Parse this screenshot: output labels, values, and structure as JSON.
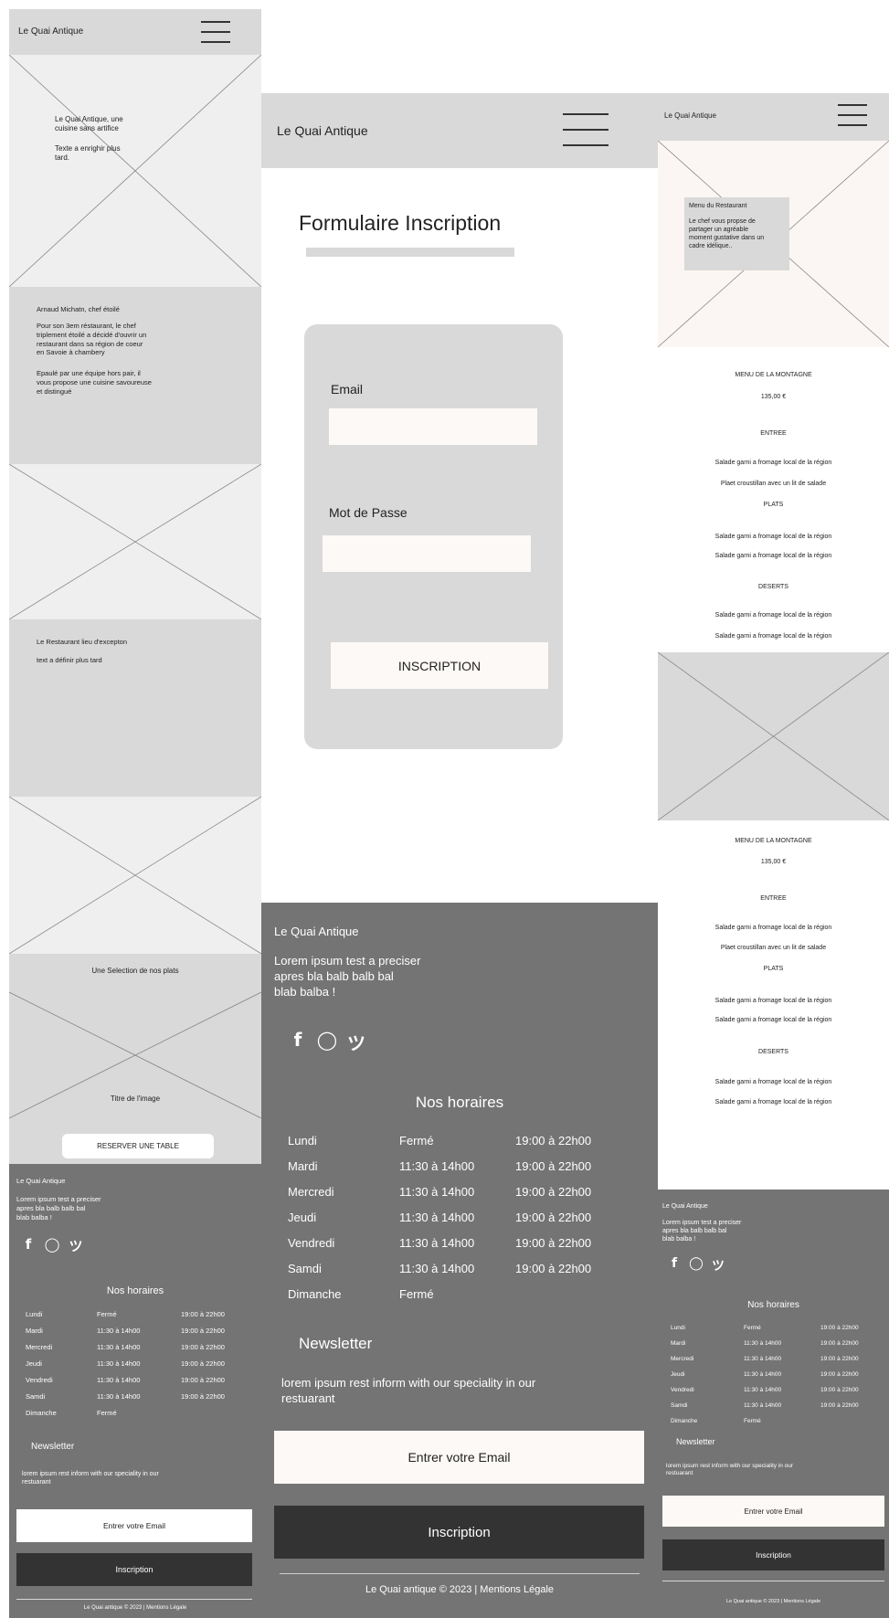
{
  "brand": "Le Quai Antique",
  "colors": {
    "header_bg": "#d9d9d9",
    "placeholder_bg": "#efefef",
    "section_bg": "#d9d9d9",
    "footer_bg": "#747474",
    "dark_button": "#333333",
    "light_field": "#fdf9f6"
  },
  "home": {
    "hero": {
      "title": "Le Quai Antique, une\ncuisine sans artifice",
      "subtitle": "Texte a enrighir plus\ntard."
    },
    "chef": {
      "title": "Arnaud Michatn, chef étoilé",
      "p1": "Pour son 3em réstaurant, le chef\ntriplement étoilé a décidé d'ouvrir un\nrestaurant dans sa région de coeur\nen Savoie à chambery",
      "p2": "Epaulé par une équipe hors pair, il\nvous propose une cuisine savoureuse\net distingué"
    },
    "restaurant": {
      "title": "Le Restaurant lieu d'excepton",
      "text": "text a définir plus tard"
    },
    "selection": {
      "title": "Une Selection de nos plats",
      "image_title": "Titre de l'image",
      "reserve_button": "RESERVER UNE TABLE"
    }
  },
  "signup": {
    "title": "Formulaire Inscription",
    "email_label": "Email",
    "password_label": "Mot de Passe",
    "submit": "INSCRIPTION"
  },
  "menu": {
    "hero_card": {
      "title": "Menu du Restaurant",
      "text": "Le chef vous propse de\npartager un agréable\nmoment gustative dans un\ncadre idélique.."
    },
    "blocks": [
      {
        "name": "MENU DE LA MONTAGNE",
        "price": "135,00 €",
        "entree_title": "ENTREE",
        "entree": [
          "Salade garni a fromage local de la région",
          "Plaet croustillan avec un lit de salade"
        ],
        "plats_title": "PLATS",
        "plats": [
          "Salade garni a fromage local de la région",
          "Salade garni a fromage local de la région"
        ],
        "deserts_title": "DESERTS",
        "deserts": [
          "Salade garni a fromage local de la région",
          "Salade garni a fromage local de la région"
        ]
      },
      {
        "name": "MENU DE LA MONTAGNE",
        "price": "135,00 €",
        "entree_title": "ENTREE",
        "entree": [
          "Salade garni a fromage local de la région",
          "Plaet croustillan avec un lit de salade"
        ],
        "plats_title": "PLATS",
        "plats": [
          "Salade garni a fromage local de la région",
          "Salade garni a fromage local de la région"
        ],
        "deserts_title": "DESERTS",
        "deserts": [
          "Salade garni a fromage local de la région",
          "Salade garni a fromage local de la région"
        ]
      }
    ]
  },
  "footer": {
    "brand": "Le Quai Antique",
    "text": "Lorem ipsum test a preciser\napres bla balb balb bal\nblab balba !",
    "social_icons": [
      "facebook-icon",
      "github-icon",
      "twitter-icon"
    ],
    "hours_title": "Nos horaires",
    "hours": [
      {
        "day": "Lundi",
        "lunch": "Fermé",
        "dinner": "19:00 à  22h00"
      },
      {
        "day": "Mardi",
        "lunch": "11:30 à 14h00",
        "dinner": "19:00 à  22h00"
      },
      {
        "day": "Mercredi",
        "lunch": "11:30 à 14h00",
        "dinner": "19:00 à  22h00"
      },
      {
        "day": "Jeudi",
        "lunch": "11:30 à 14h00",
        "dinner": "19:00 à  22h00"
      },
      {
        "day": "Vendredi",
        "lunch": "11:30 à 14h00",
        "dinner": "19:00 à  22h00"
      },
      {
        "day": "Samdi",
        "lunch": "11:30 à 14h00",
        "dinner": "19:00 à  22h00"
      },
      {
        "day": "Dimanche",
        "lunch": "Fermé",
        "dinner": ""
      }
    ],
    "newsletter_title": "Newsletter",
    "newsletter_text": "lorem ipsum rest inform with our speciality in our\nrestuarant",
    "email_placeholder": "Entrer votre Email",
    "subscribe": "Inscription",
    "copyright": "Le Quai antique © 2023 | Mentions Légale"
  }
}
